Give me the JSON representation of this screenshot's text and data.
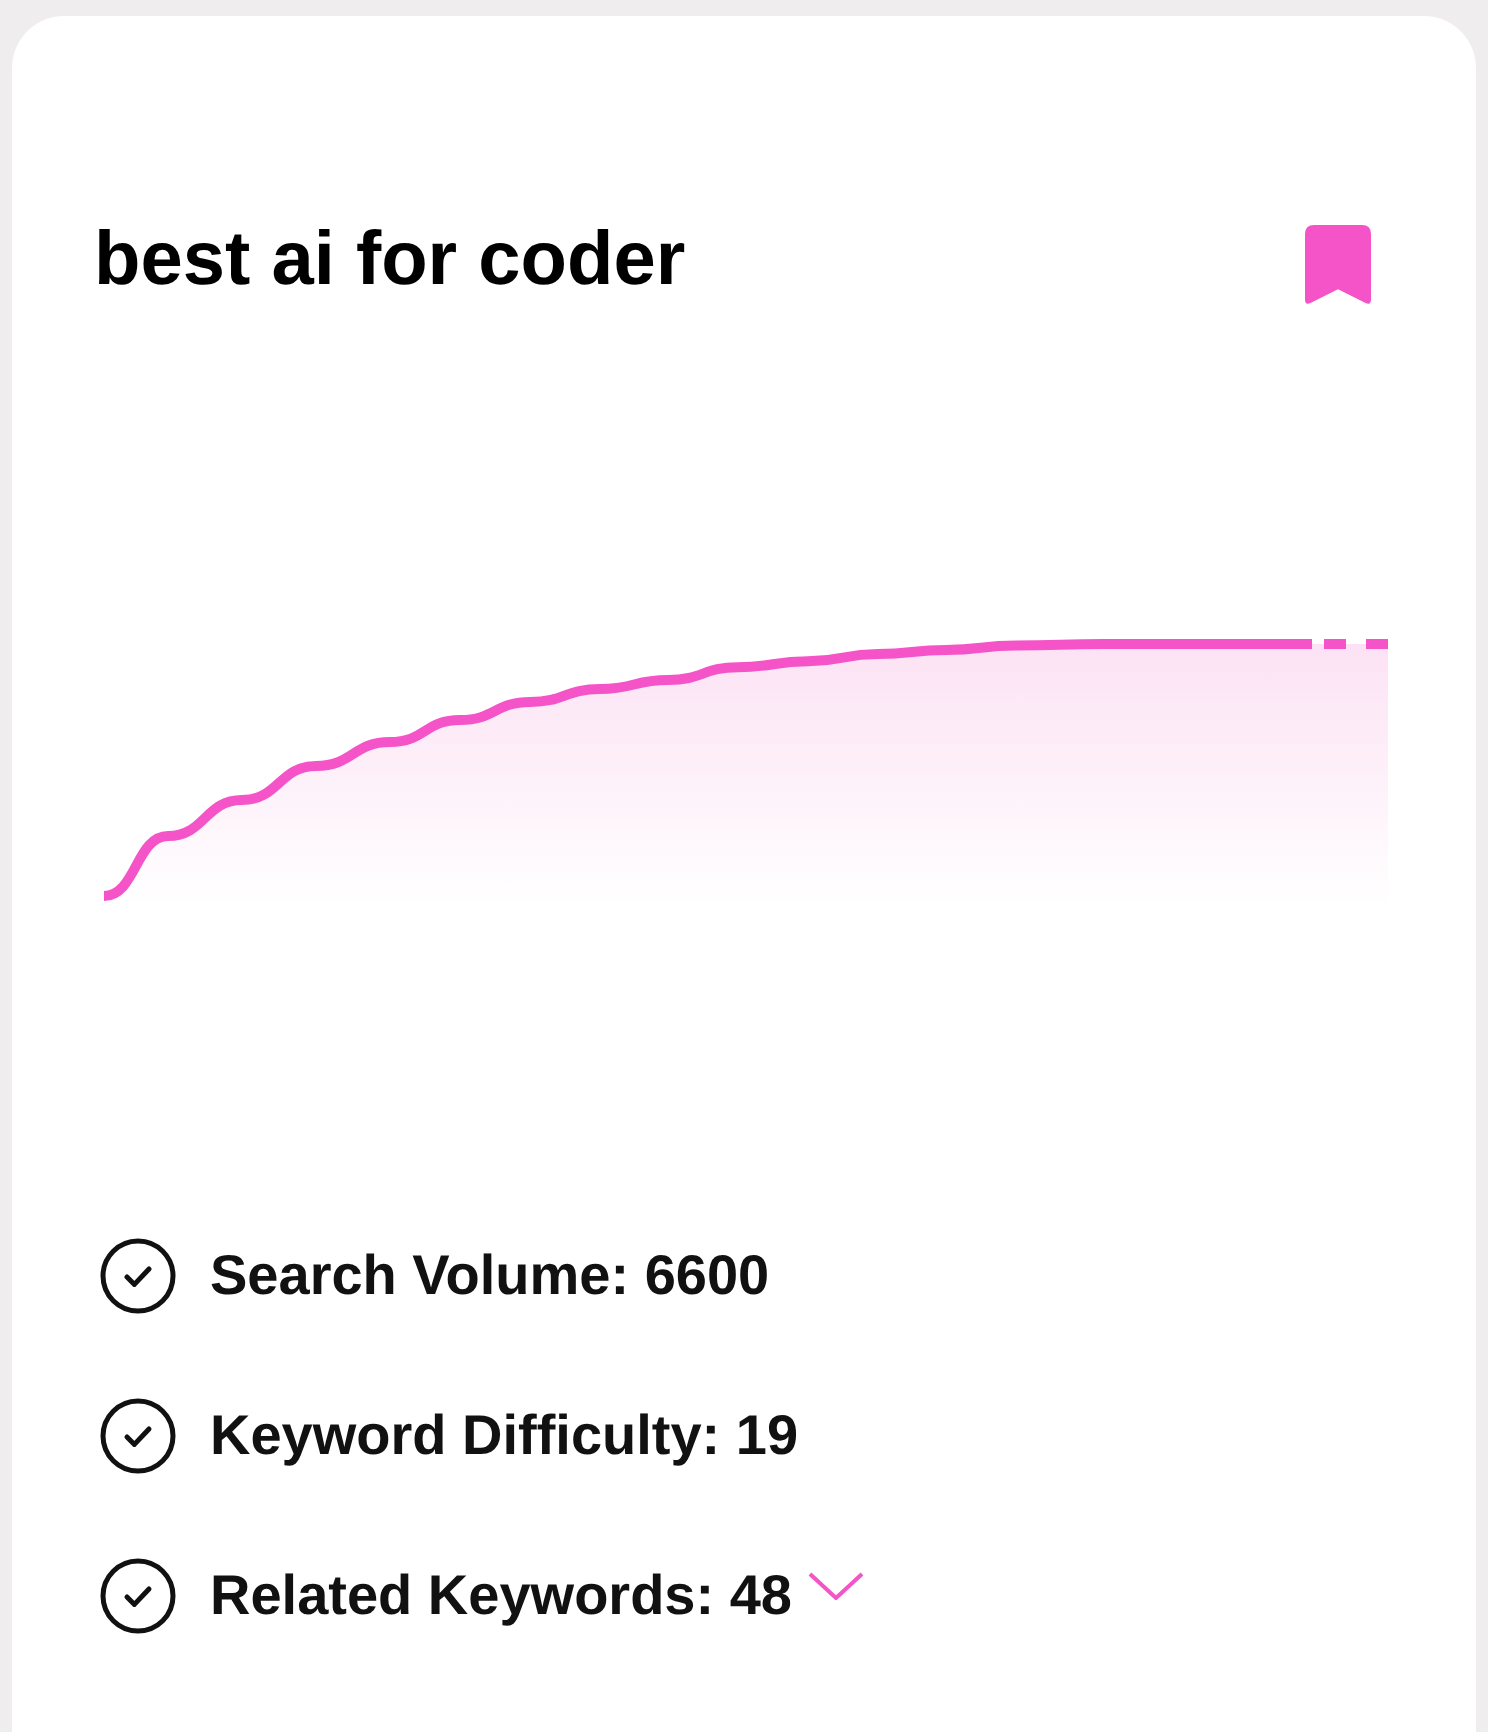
{
  "card": {
    "title": "best ai for coder",
    "bookmarked": true
  },
  "stats": [
    {
      "kind": "plain",
      "text": "Search Volume: 6600"
    },
    {
      "kind": "plain",
      "text": "Keyword Difficulty: 19"
    },
    {
      "kind": "expandable",
      "text": "Related Keywords: 48"
    }
  ]
}
